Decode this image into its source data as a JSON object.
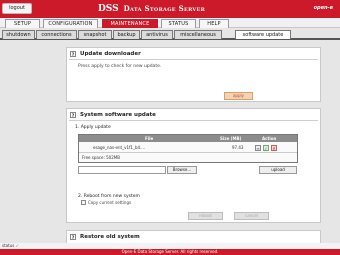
{
  "header": {
    "logout_label": "logout",
    "brand": "DSS",
    "brand_sub": "Data Storage Server",
    "logo": "open-e"
  },
  "main_tabs": [
    {
      "label": "SETUP",
      "active": false
    },
    {
      "label": "CONFIGURATION",
      "active": false
    },
    {
      "label": "MAINTENANCE",
      "active": true
    },
    {
      "label": "STATUS",
      "active": false
    },
    {
      "label": "HELP",
      "active": false
    }
  ],
  "sub_tabs": [
    {
      "label": "shutdown",
      "active": false
    },
    {
      "label": "connections",
      "active": false
    },
    {
      "label": "snapshot",
      "active": false
    },
    {
      "label": "backup",
      "active": false
    },
    {
      "label": "antivirus",
      "active": false
    },
    {
      "label": "miscellaneous",
      "active": false
    },
    {
      "label": "software update",
      "active": true
    }
  ],
  "update_downloader": {
    "title": "Update downloader",
    "description": "Press apply to check for new update.",
    "apply_label": "apply"
  },
  "system_update": {
    "title": "System software update",
    "apply_update_heading": "1. Apply update",
    "table": {
      "headers": [
        "File",
        "Size (MB)",
        "Action"
      ],
      "rows": [
        {
          "file": "esage_nas-ent_v1f1_b4....",
          "size": "97.43"
        }
      ],
      "free_space": "Free space: 502MB"
    },
    "browse_label": "Browse...",
    "upload_label": "upload",
    "reboot_heading": "2. Reboot from new system",
    "copy_settings_label": "Copy current settings",
    "reboot_label": "reboot",
    "cancel_label": "cancel"
  },
  "restore": {
    "title": "Restore old system"
  },
  "status": {
    "label": "status"
  },
  "footer": {
    "text": "Open-E Data Storage Server. All rights reserved."
  }
}
